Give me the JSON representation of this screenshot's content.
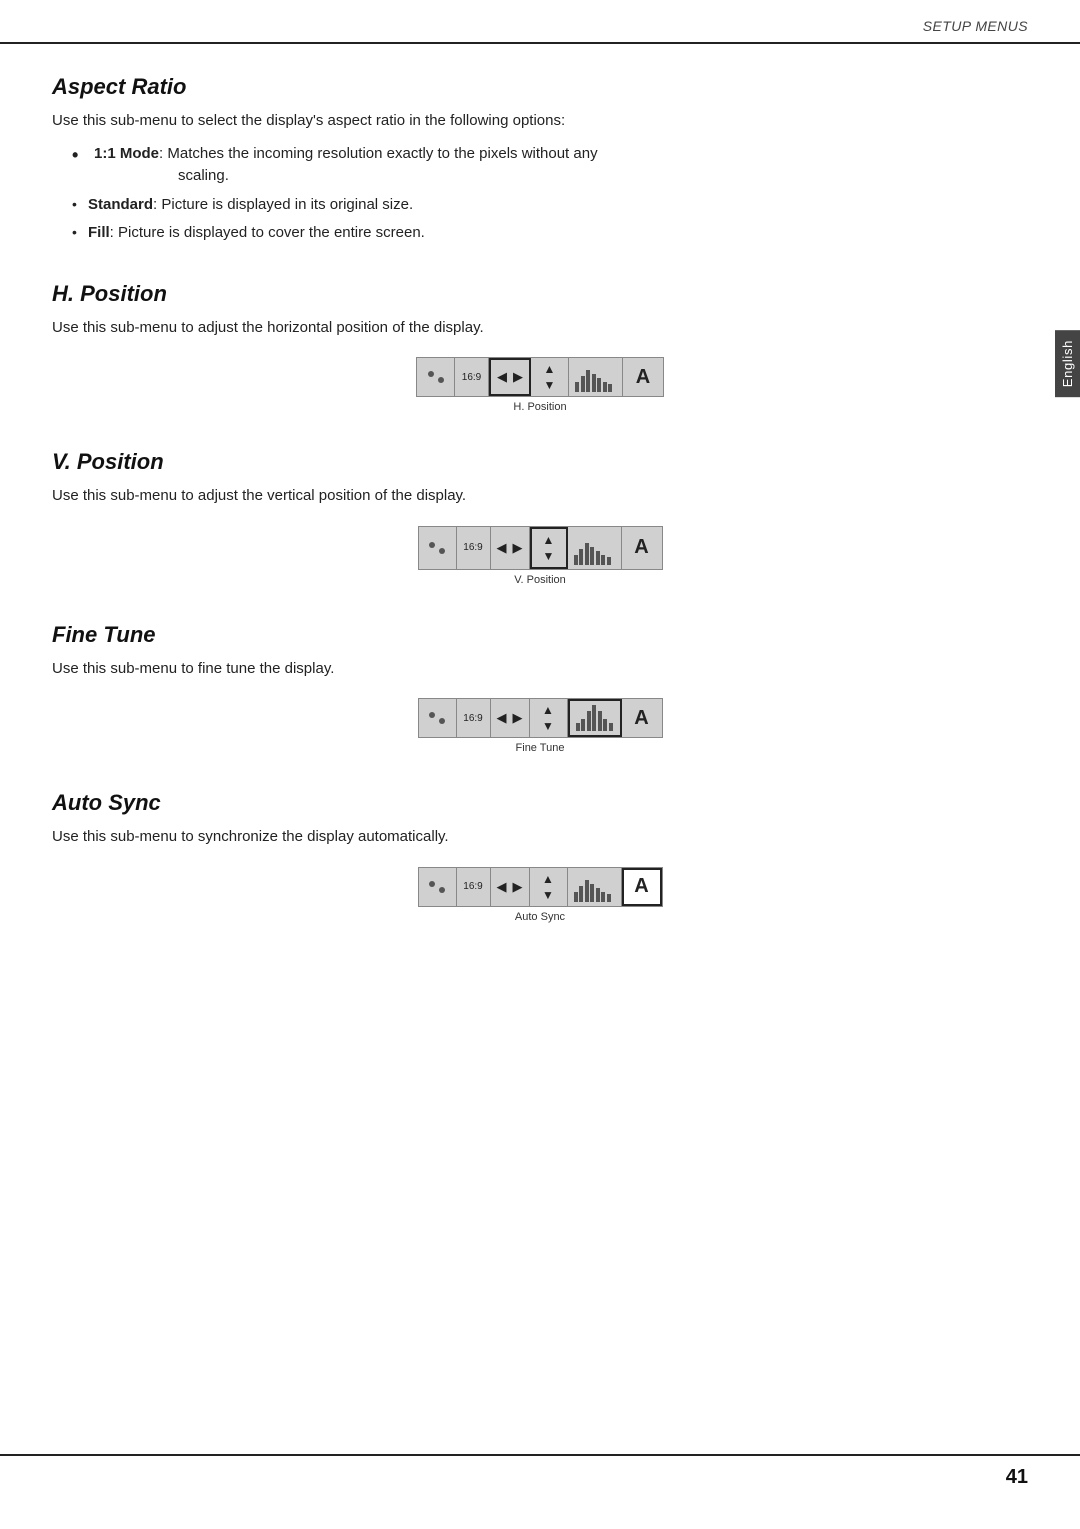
{
  "header": {
    "setup_menus": "SETUP MENUS"
  },
  "english_tab": "English",
  "sections": {
    "aspect_ratio": {
      "title": "Aspect Ratio",
      "intro": "Use this sub-menu to select the display's aspect ratio in the following options:",
      "bullets": [
        {
          "label": "1:1 Mode",
          "text": ": Matches the incoming resolution exactly to the pixels without any",
          "continuation": "scaling.",
          "bold": true,
          "large_dot": true
        },
        {
          "label": "Standard",
          "text": ": Picture is displayed in its original size.",
          "bold": true,
          "large_dot": false
        },
        {
          "label": "Fill",
          "text": ": Picture is displayed to cover the entire screen.",
          "bold": true,
          "large_dot": false
        }
      ]
    },
    "h_position": {
      "title": "H. Position",
      "intro": "Use this sub-menu to adjust the horizontal position of the display.",
      "diagram_label": "H. Position",
      "ratio_label": "16:9"
    },
    "v_position": {
      "title": "V. Position",
      "intro": "Use this sub-menu to adjust the vertical position of the display.",
      "diagram_label": "V. Position",
      "ratio_label": "16:9"
    },
    "fine_tune": {
      "title": "Fine Tune",
      "intro": "Use this sub-menu to fine tune the display.",
      "diagram_label": "Fine Tune",
      "ratio_label": "16:9"
    },
    "auto_sync": {
      "title": "Auto Sync",
      "intro": "Use this sub-menu to synchronize the display automatically.",
      "diagram_label": "Auto Sync",
      "ratio_label": "16:9"
    }
  },
  "page_number": "41"
}
